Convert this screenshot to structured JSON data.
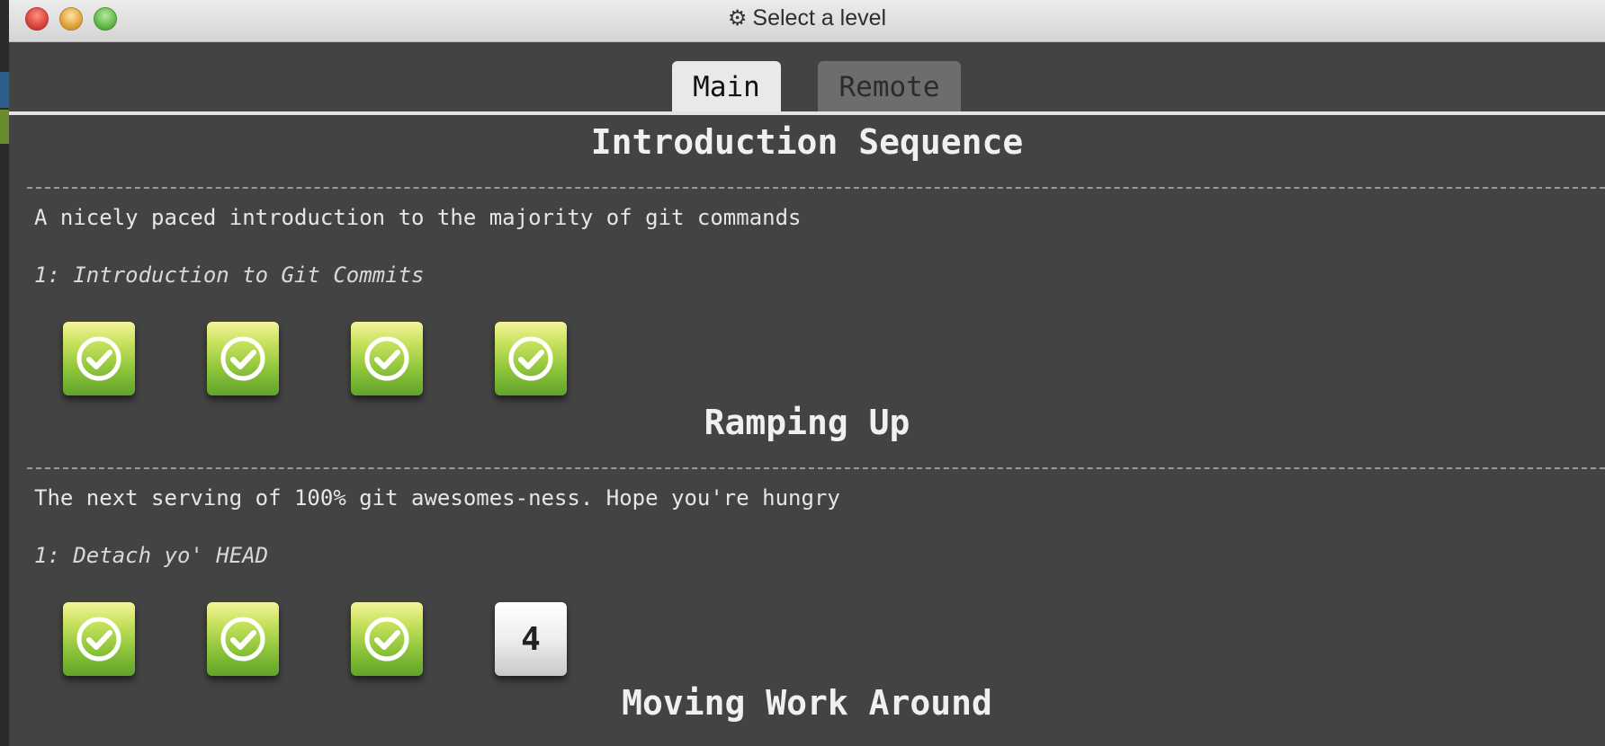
{
  "window": {
    "title": "Select a level",
    "title_icon": "gear-icon"
  },
  "tabs": [
    {
      "label": "Main",
      "active": true
    },
    {
      "label": "Remote",
      "active": false
    }
  ],
  "sequences": [
    {
      "title": "Introduction Sequence",
      "description": "A nicely paced introduction to the majority of git commands",
      "current_level": "1: Introduction to Git Commits",
      "levels": [
        {
          "status": "completed",
          "icon": "check-circle-icon"
        },
        {
          "status": "completed",
          "icon": "check-circle-icon"
        },
        {
          "status": "completed",
          "icon": "check-circle-icon"
        },
        {
          "status": "completed",
          "icon": "check-circle-icon"
        }
      ]
    },
    {
      "title": "Ramping Up",
      "description": "The next serving of 100% git awesomes-ness. Hope you're hungry",
      "current_level": "1: Detach yo' HEAD",
      "levels": [
        {
          "status": "completed",
          "icon": "check-circle-icon"
        },
        {
          "status": "completed",
          "icon": "check-circle-icon"
        },
        {
          "status": "completed",
          "icon": "check-circle-icon"
        },
        {
          "status": "incomplete",
          "label": "4"
        }
      ]
    },
    {
      "title": "Moving Work Around"
    }
  ],
  "colors": {
    "background": "#434343",
    "completed_green": "#8dc43a",
    "tab_active": "#e9e9e9",
    "tab_inactive": "#6d6d6d"
  }
}
